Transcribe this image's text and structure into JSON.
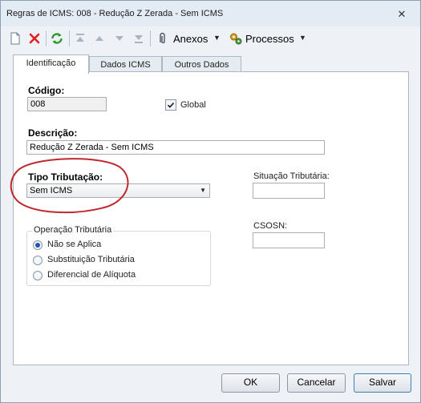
{
  "window": {
    "title": "Regras de ICMS: 008 - Redução Z Zerada - Sem ICMS",
    "close_symbol": "✕"
  },
  "toolbar": {
    "icons": [
      "new-icon",
      "delete-icon",
      "refresh-icon",
      "first-icon",
      "prev-icon",
      "next-icon",
      "last-icon"
    ],
    "anexos_label": "Anexos",
    "processos_label": "Processos"
  },
  "tabs": [
    {
      "label": "Identificação",
      "active": true
    },
    {
      "label": "Dados ICMS",
      "active": false
    },
    {
      "label": "Outros Dados",
      "active": false
    }
  ],
  "form": {
    "codigo_label": "Código:",
    "codigo_value": "008",
    "global_label": "Global",
    "global_checked": true,
    "descricao_label": "Descrição:",
    "descricao_value": "Redução Z Zerada - Sem ICMS",
    "tipo_label": "Tipo Tributação:",
    "tipo_value": "Sem ICMS",
    "situacao_label": "Situação Tributária:",
    "situacao_value": "",
    "csosn_label": "CSOSN:",
    "csosn_value": "",
    "operacao_group_label": "Operação Tributária",
    "operacao_options": [
      {
        "label": "Não se Aplica",
        "selected": true
      },
      {
        "label": "Substituição Tributária",
        "selected": false
      },
      {
        "label": "Diferencial de Alíquota",
        "selected": false
      }
    ]
  },
  "buttons": {
    "ok": "OK",
    "cancel": "Cancelar",
    "save": "Salvar"
  },
  "colors": {
    "accent": "#1c57b8",
    "annotation": "#c0282d"
  }
}
